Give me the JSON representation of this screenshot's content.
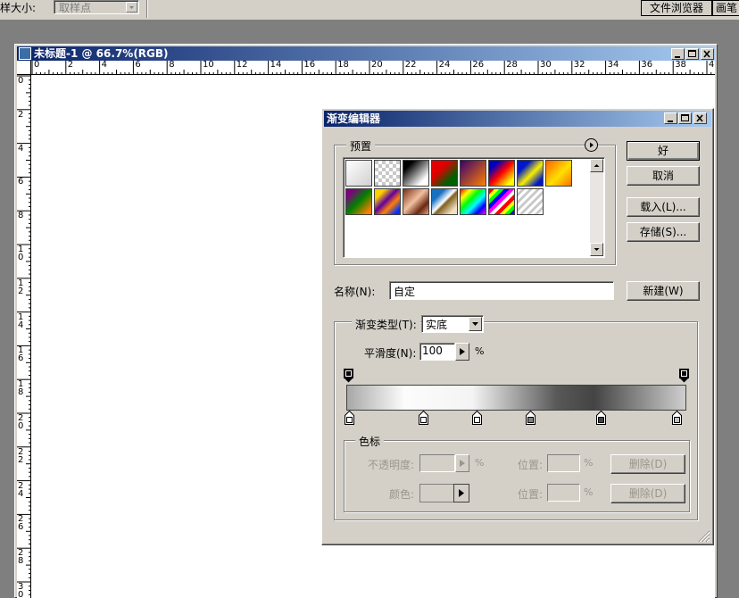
{
  "toolbar": {
    "sample_size_label": "样大小:",
    "sample_select_value": "取样点",
    "tab_file_browser": "文件浏览器",
    "tab_brushes": "画笔"
  },
  "document": {
    "title": "未标题-1 @ 66.7%(RGB)",
    "ruler_h": [
      "0",
      "2",
      "4",
      "6",
      "8",
      "10",
      "12",
      "14",
      "16",
      "18",
      "20",
      "22",
      "24",
      "26",
      "28",
      "30",
      "32",
      "34",
      "36",
      "38",
      "40"
    ],
    "ruler_v": [
      "0",
      "2",
      "4",
      "6",
      "8",
      "10",
      "12",
      "14",
      "16",
      "18",
      "20",
      "22",
      "24",
      "26",
      "28",
      "30"
    ]
  },
  "dialog": {
    "title": "渐变编辑器",
    "presets_label": "预置",
    "ok_label": "好",
    "cancel_label": "取消",
    "load_label": "载入(L)...",
    "save_label": "存储(S)...",
    "name_label": "名称(N):",
    "name_value": "自定",
    "new_label": "新建(W)",
    "gradient_type_label": "渐变类型(T):",
    "gradient_type_value": "实底",
    "smoothness_label": "平滑度(N):",
    "smoothness_value": "100",
    "percent": "%",
    "stops_label": "色标",
    "opacity_label": "不透明度:",
    "color_label": "颜色:",
    "location_label": "位置:",
    "delete_label": "删除(D)",
    "presets": [
      {
        "name": "foreground-to-background",
        "css": "linear-gradient(135deg,#ffffff,#d0d0d0)"
      },
      {
        "name": "foreground-to-transparent",
        "css": "repeating-conic-gradient(#fff 0% 25%,#c8c8c8 0% 50%) 0 0/8px 8px"
      },
      {
        "name": "black-white",
        "css": "linear-gradient(135deg,#000 20%,#fff 80%)"
      },
      {
        "name": "red-green",
        "css": "linear-gradient(135deg,#e00000 35%,#006000 75%)"
      },
      {
        "name": "violet-orange",
        "css": "linear-gradient(135deg,#3a0070,#ff8000)"
      },
      {
        "name": "blue-red-yellow",
        "css": "linear-gradient(135deg,#0000c0 20%,#ff0000 50%,#ffff00 85%)"
      },
      {
        "name": "blue-yellow-blue",
        "css": "linear-gradient(135deg,#0018c8 25%,#f8f000 55%,#0018c8 85%)"
      },
      {
        "name": "orange-yellow-orange",
        "css": "linear-gradient(135deg,#ff6000,#ffe000 55%,#ff7000)"
      },
      {
        "name": "violet-green-orange",
        "css": "linear-gradient(135deg,#800080 15%,#008000 50%,#ff8000 90%)"
      },
      {
        "name": "yellow-violet-orange-blue",
        "css": "linear-gradient(135deg,#ffd000 20%,#6000a0 45%,#ff8000 65%,#0030ff 90%)"
      },
      {
        "name": "copper",
        "css": "linear-gradient(135deg,#7a3014,#f0c0a0 45%,#6a2810 75%,#e0a080)"
      },
      {
        "name": "chrome",
        "css": "linear-gradient(135deg,#1870c0 25%,#ffffff 48%,#806020 55%,#f0e0c0 85%)"
      },
      {
        "name": "spectrum",
        "css": "linear-gradient(135deg,#ff0000,#ffff00,#00ff00,#00ffff,#0000ff,#ff00ff)"
      },
      {
        "name": "transparent-rainbow",
        "css": "repeating-linear-gradient(135deg,#ff0000 0 4px,#ff0 4px 8px,#0f0 8px 12px,#00f 12px 16px,#f0f 16px 20px,#fff 20px 24px)"
      },
      {
        "name": "transparent-stripes",
        "css": "repeating-linear-gradient(135deg,#ffffff 0 3px,#c8c8c8 3px 6px)"
      }
    ]
  },
  "colors": {
    "titlebar_start": "#0a246a",
    "titlebar_end": "#a6caf0",
    "face": "#d4d0c8"
  }
}
